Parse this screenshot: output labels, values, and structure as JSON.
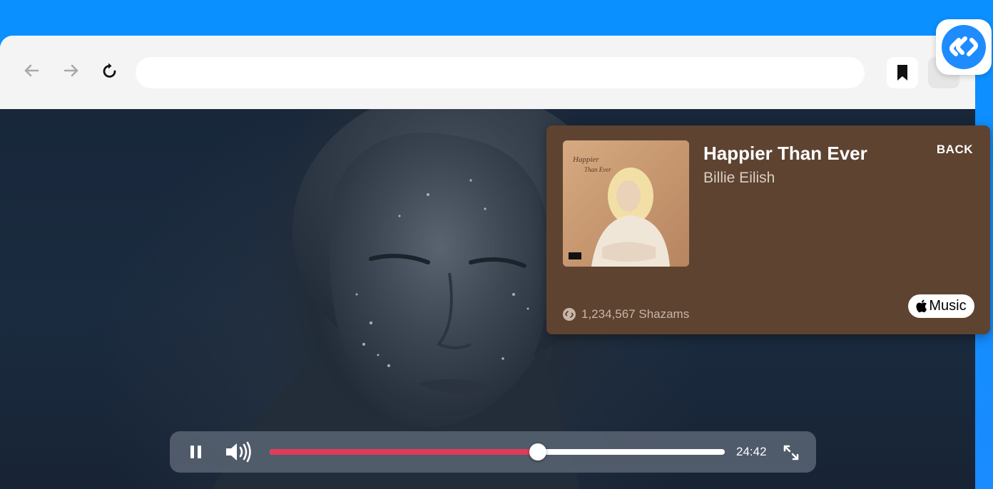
{
  "colors": {
    "background_blue": "#0a90ff",
    "card_brown": "#5e4331",
    "progress_red": "#e23a5a",
    "shazam_blue": "#1e8cff"
  },
  "toolbar": {
    "back_icon": "arrow-left-icon",
    "forward_icon": "arrow-right-icon",
    "reload_icon": "reload-icon",
    "address_value": "",
    "bookmark_icon": "bookmark-icon",
    "extension_icon": "shazam-logo-icon"
  },
  "song_card": {
    "title": "Happier Than Ever",
    "artist": "Billie Eilish",
    "back_label": "BACK",
    "shazam_count": "1,234,567 Shazams",
    "apple_music_label": "Music",
    "album_art_text": "Happier Than Ever"
  },
  "player": {
    "time": "24:42",
    "progress_fraction": 0.59,
    "pause_icon": "pause-icon",
    "volume_icon": "volume-icon",
    "fullscreen_icon": "fullscreen-icon"
  }
}
